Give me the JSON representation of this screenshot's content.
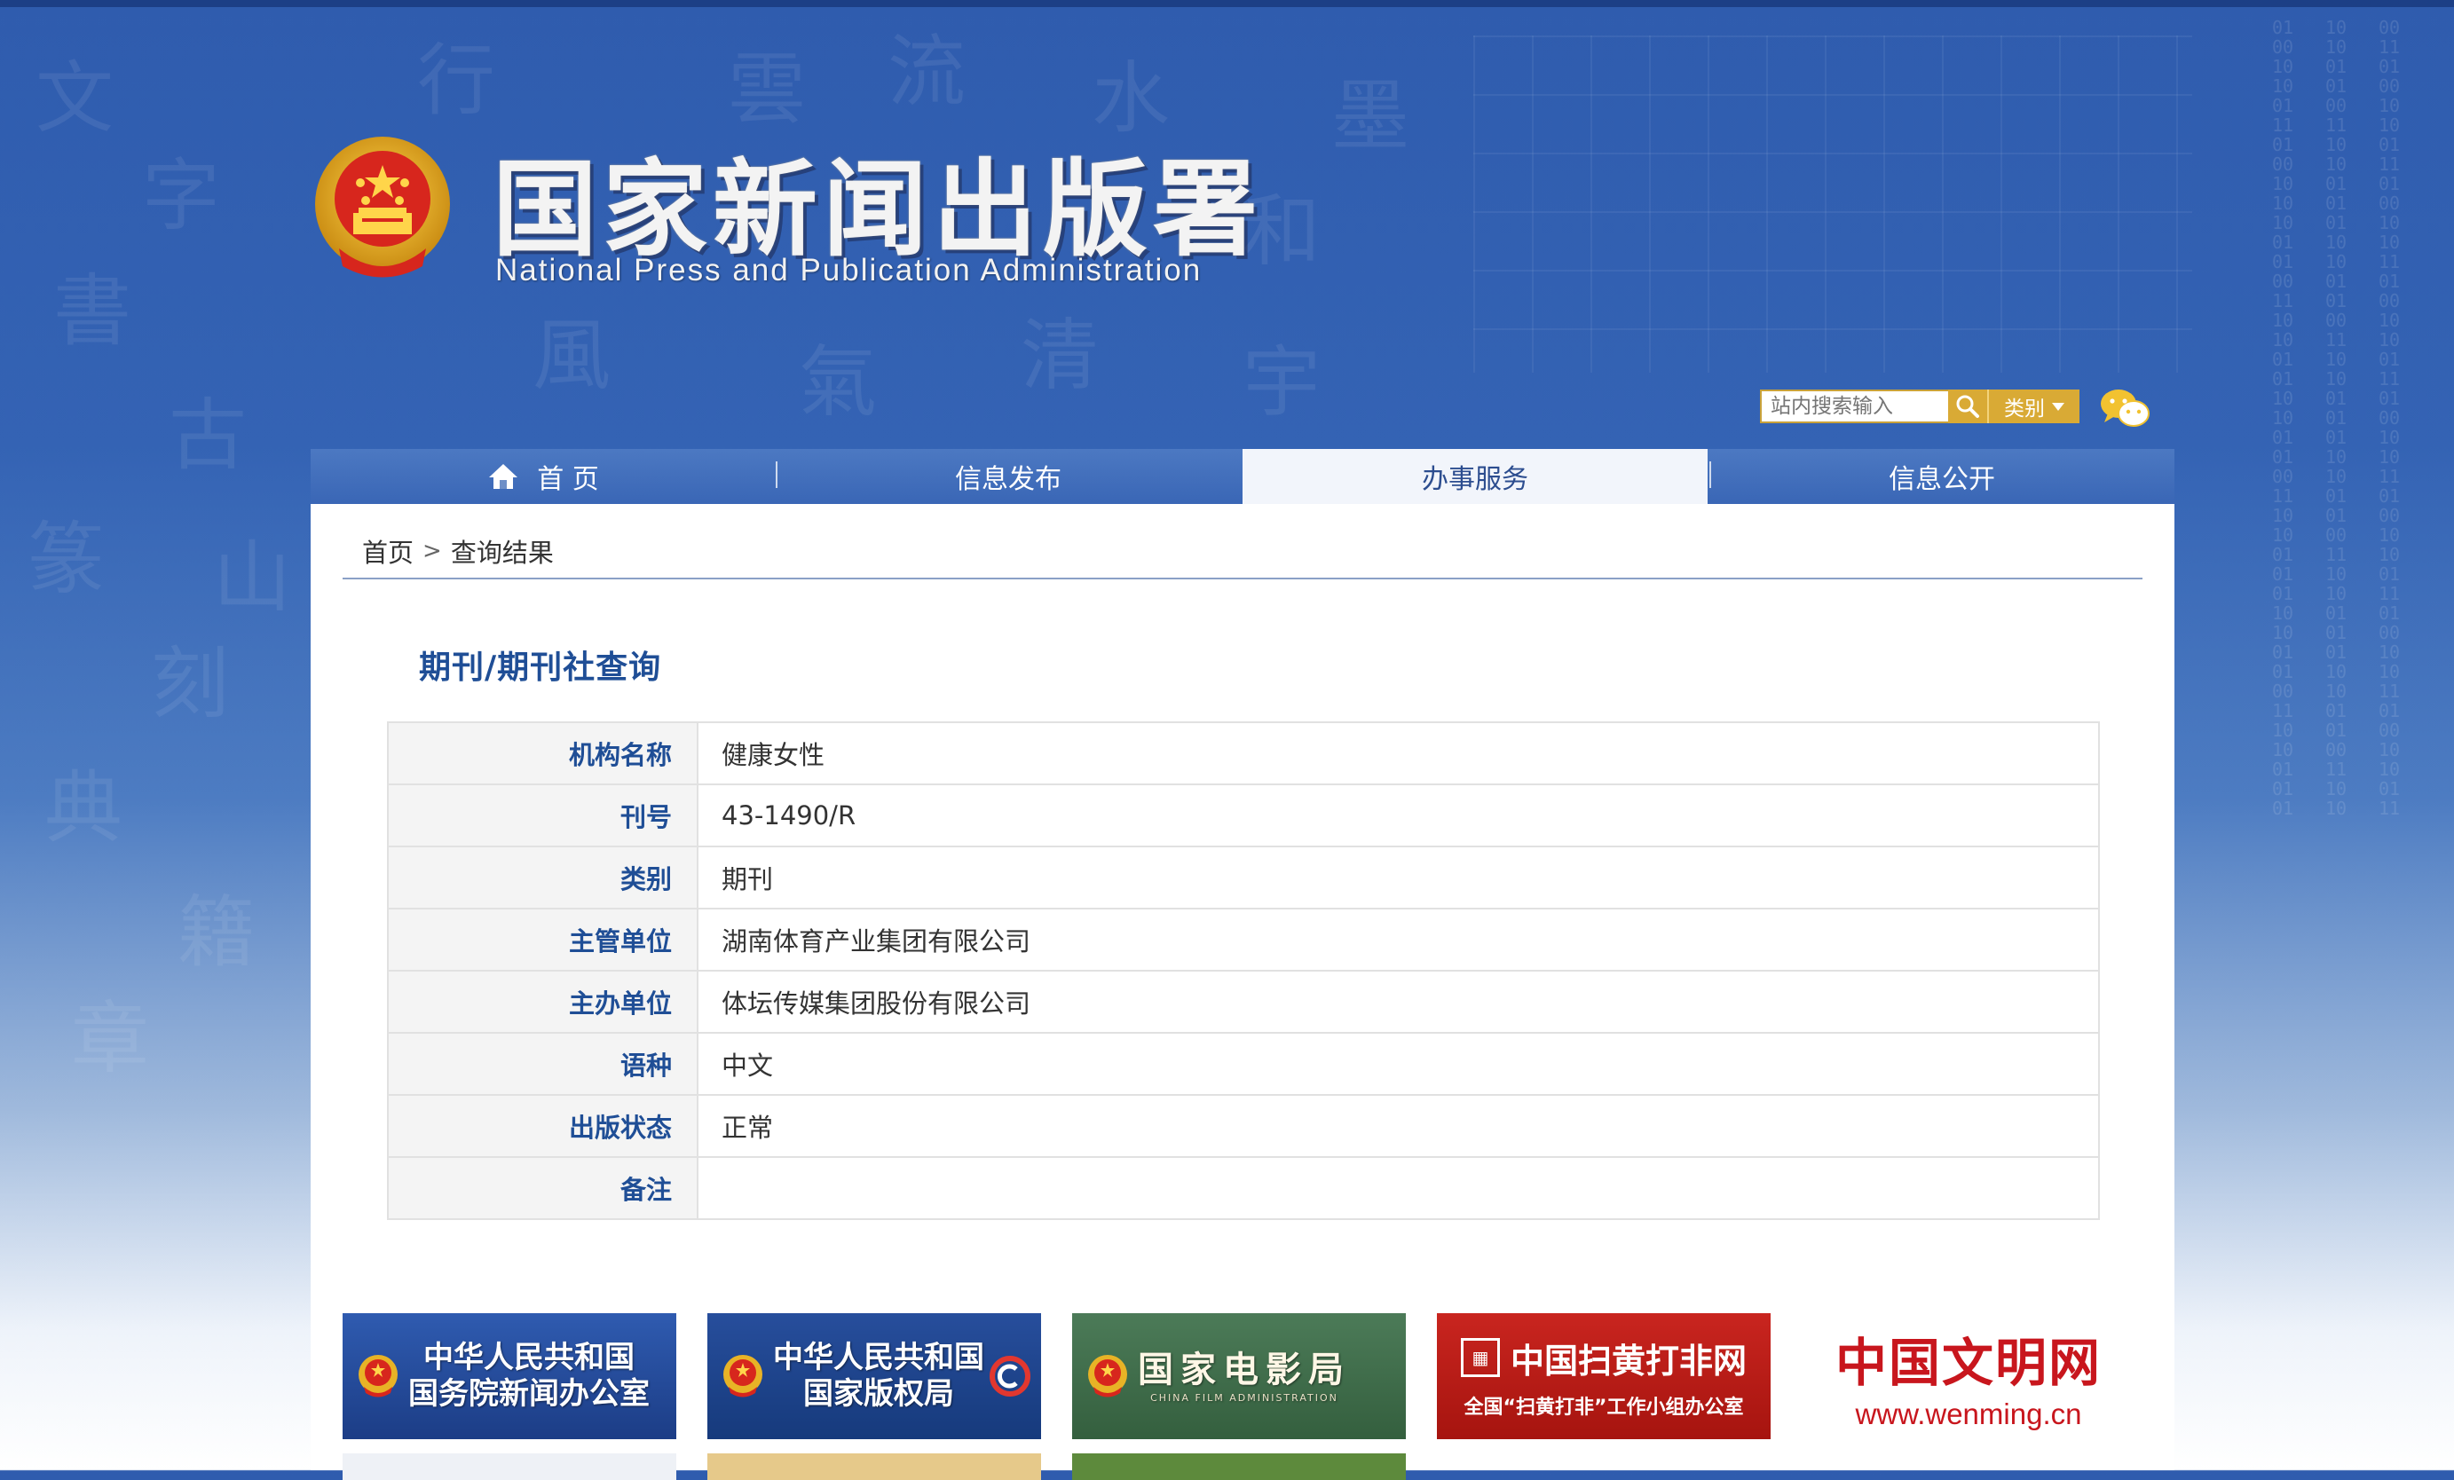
{
  "header": {
    "site_title": "国家新闻出版署",
    "site_subtitle": "National  Press and Publication Administration"
  },
  "search": {
    "placeholder": "站内搜索输入",
    "category_label": "类别"
  },
  "nav": {
    "items": [
      {
        "label": "首 页",
        "icon": "home-icon"
      },
      {
        "label": "信息发布"
      },
      {
        "label": "办事服务",
        "active": true
      },
      {
        "label": "信息公开"
      }
    ]
  },
  "breadcrumb": {
    "home": "首页",
    "separator": ">",
    "current": "查询结果"
  },
  "section_title": "期刊/期刊社查询",
  "record": {
    "rows": [
      {
        "label": "机构名称",
        "value": "健康女性"
      },
      {
        "label": "刊号",
        "value": "43-1490/R"
      },
      {
        "label": "类别",
        "value": "期刊"
      },
      {
        "label": "主管单位",
        "value": "湖南体育产业集团有限公司"
      },
      {
        "label": "主办单位",
        "value": "体坛传媒集团股份有限公司"
      },
      {
        "label": "语种",
        "value": "中文"
      },
      {
        "label": "出版状态",
        "value": "正常"
      },
      {
        "label": "备注",
        "value": ""
      }
    ]
  },
  "banners": [
    {
      "line1": "中华人民共和国",
      "line2": "国务院新闻办公室"
    },
    {
      "line1": "中华人民共和国",
      "line2": "国家版权局"
    },
    {
      "line1": "国家电影局",
      "sub": "CHINA FILM ADMINISTRATION"
    },
    {
      "line1": "中国扫黄打非网",
      "line2": "全国“扫黄打非”工作小组办公室"
    },
    {
      "line1": "中国文明网",
      "line2": "www.wenming.cn"
    }
  ],
  "colors": {
    "brand_blue": "#1f4e96",
    "gold": "#d9aa35",
    "red": "#c8161d"
  }
}
